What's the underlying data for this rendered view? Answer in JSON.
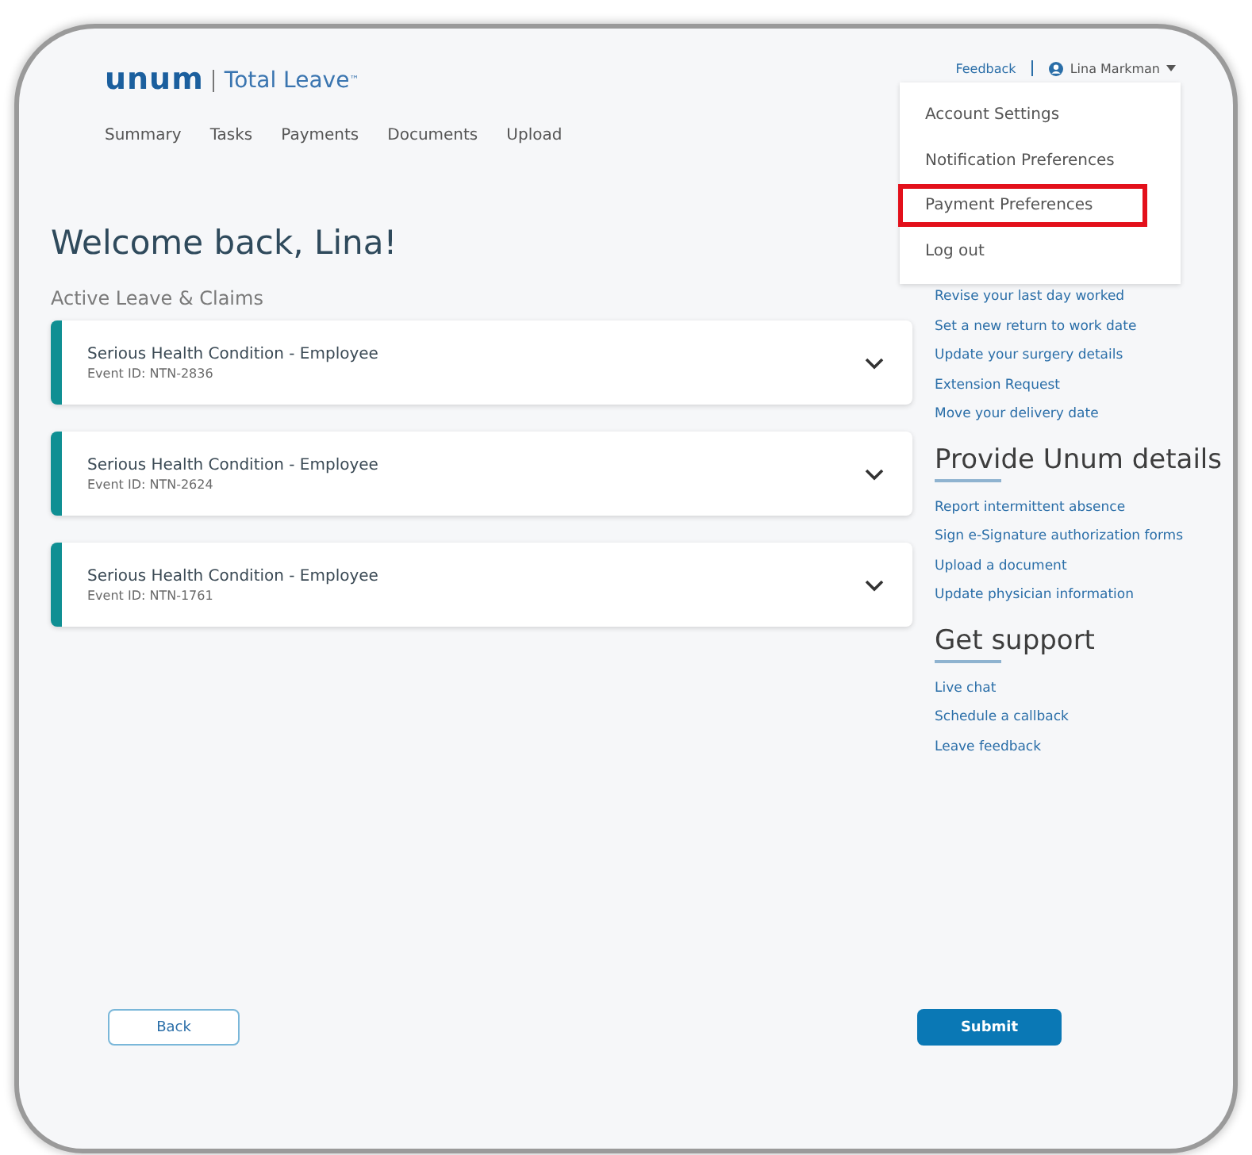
{
  "logo": {
    "brand": "unum",
    "product": "Total Leave",
    "trademark": "™"
  },
  "nav": [
    "Summary",
    "Tasks",
    "Payments",
    "Documents",
    "Upload"
  ],
  "header": {
    "feedback": "Feedback",
    "user_name": "Lina Markman"
  },
  "user_menu": [
    {
      "label": "Account Settings",
      "highlighted": false
    },
    {
      "label": "Notification Preferences",
      "highlighted": false
    },
    {
      "label": "Payment Preferences",
      "highlighted": true
    },
    {
      "label": "Log out",
      "highlighted": false
    }
  ],
  "welcome": "Welcome back, Lina!",
  "claims_title": "Active Leave & Claims",
  "claims": [
    {
      "title": "Serious Health Condition - Employee",
      "event_id": "Event ID: NTN-2836"
    },
    {
      "title": "Serious Health Condition - Employee",
      "event_id": "Event ID: NTN-2624"
    },
    {
      "title": "Serious Health Condition - Employee",
      "event_id": "Event ID: NTN-1761"
    }
  ],
  "sidebar": [
    {
      "links": [
        "Revise your last day worked",
        "Set a new return to work date",
        "Update your surgery details",
        "Extension Request",
        "Move your delivery date"
      ]
    },
    {
      "title": "Provide Unum details",
      "links": [
        "Report intermittent absence",
        "Sign e-Signature authorization forms",
        "Upload a document",
        "Update physician information"
      ]
    },
    {
      "title": "Get support",
      "links": [
        "Live chat",
        "Schedule a callback",
        "Leave feedback"
      ]
    }
  ],
  "buttons": {
    "back": "Back",
    "submit": "Submit"
  }
}
